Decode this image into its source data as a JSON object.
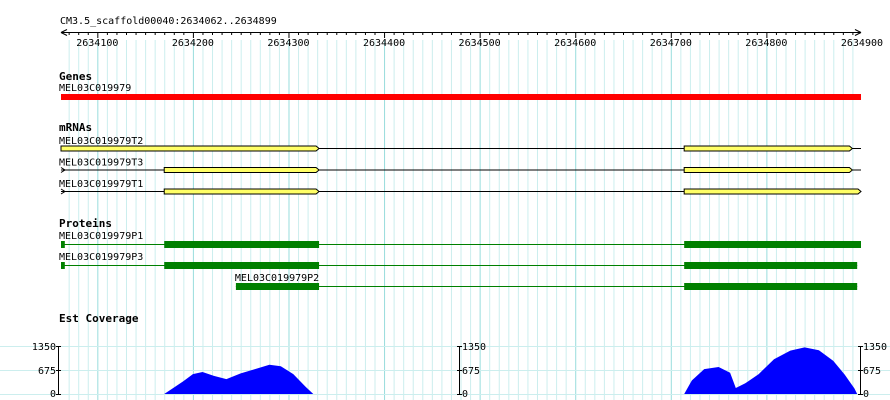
{
  "region_label": "CM3.5_scaffold00040:2634062..2634899",
  "ruler": {
    "start": 2634062,
    "end": 2634899,
    "ticks": [
      "2634100",
      "2634200",
      "2634300",
      "2634400",
      "2634500",
      "2634600",
      "2634700",
      "2634800",
      "2634900"
    ]
  },
  "colors": {
    "gene": "#ff0000",
    "mrna_exon": "#ffff66",
    "mrna_outline": "#000000",
    "protein": "#008000",
    "coverage": "#0000ff",
    "grid_major": "#99dddd",
    "grid_minor": "#cceeee"
  },
  "tracks": {
    "genes": {
      "title": "Genes",
      "features": [
        {
          "name": "MEL03C019979",
          "segments": [
            [
              2634062,
              2634899
            ]
          ]
        }
      ]
    },
    "mrnas": {
      "title": "mRNAs",
      "features": [
        {
          "name": "MEL03C019979T2",
          "start": 2634062,
          "end": 2634899,
          "segments": [
            [
              2634062,
              2634332
            ],
            [
              2634714,
              2634890
            ]
          ]
        },
        {
          "name": "MEL03C019979T3",
          "start": 2634062,
          "end": 2634899,
          "segments": [
            [
              2634170,
              2634332
            ],
            [
              2634714,
              2634890
            ]
          ]
        },
        {
          "name": "MEL03C019979T1",
          "start": 2634062,
          "end": 2634899,
          "segments": [
            [
              2634170,
              2634332
            ],
            [
              2634714,
              2634899
            ]
          ]
        }
      ]
    },
    "proteins": {
      "title": "Proteins",
      "features": [
        {
          "name": "MEL03C019979P1",
          "start": 2634062,
          "end": 2634899,
          "segments": [
            [
              2634062,
              2634066
            ],
            [
              2634170,
              2634332
            ],
            [
              2634714,
              2634899
            ]
          ]
        },
        {
          "name": "MEL03C019979P3",
          "start": 2634062,
          "end": 2634895,
          "segments": [
            [
              2634062,
              2634066
            ],
            [
              2634170,
              2634332
            ],
            [
              2634714,
              2634895
            ]
          ]
        },
        {
          "name": "MEL03C019979P2",
          "start": 2634245,
          "end": 2634895,
          "segments": [
            [
              2634245,
              2634332
            ],
            [
              2634714,
              2634895
            ]
          ]
        }
      ]
    },
    "coverage": {
      "title": "Est Coverage",
      "axis": [
        "1350",
        "675",
        "0"
      ],
      "max": 1350,
      "points": [
        [
          2634170,
          0
        ],
        [
          2634180,
          180
        ],
        [
          2634190,
          360
        ],
        [
          2634200,
          560
        ],
        [
          2634210,
          620
        ],
        [
          2634222,
          510
        ],
        [
          2634235,
          420
        ],
        [
          2634250,
          580
        ],
        [
          2634265,
          700
        ],
        [
          2634280,
          820
        ],
        [
          2634292,
          780
        ],
        [
          2634305,
          560
        ],
        [
          2634318,
          200
        ],
        [
          2634326,
          0
        ],
        [
          2634714,
          0
        ],
        [
          2634722,
          380
        ],
        [
          2634735,
          700
        ],
        [
          2634750,
          760
        ],
        [
          2634762,
          600
        ],
        [
          2634768,
          170
        ],
        [
          2634778,
          300
        ],
        [
          2634792,
          560
        ],
        [
          2634808,
          980
        ],
        [
          2634825,
          1220
        ],
        [
          2634840,
          1310
        ],
        [
          2634855,
          1230
        ],
        [
          2634870,
          930
        ],
        [
          2634882,
          540
        ],
        [
          2634892,
          160
        ],
        [
          2634895,
          0
        ]
      ]
    }
  }
}
